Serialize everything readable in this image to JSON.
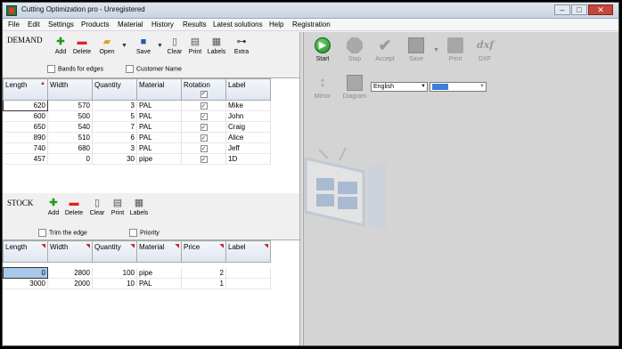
{
  "window": {
    "title": "Cutting Optimization pro - Unregistered",
    "controls": {
      "minimize": "–",
      "maximize": "□",
      "close": "✕"
    }
  },
  "menu": [
    "File",
    "Edit",
    "Settings",
    "Products",
    "Material",
    "History",
    "Results",
    "Latest solutions",
    "Help",
    "Registration"
  ],
  "demand": {
    "title": "DEMAND",
    "toolbar": {
      "add": "Add",
      "delete": "Delete",
      "open": "Open",
      "save": "Save",
      "clear": "Clear",
      "print": "Print",
      "labels": "Labels",
      "extra": "Extra"
    },
    "bands_for_edges": "Bands for edges",
    "customer_name": "Customer Name",
    "columns": [
      "Length",
      "Width",
      "Quantity",
      "Material",
      "Rotation",
      "Label"
    ],
    "rows": [
      {
        "length": "620",
        "width": "570",
        "quantity": "3",
        "material": "PAL",
        "rotation": true,
        "label": "Mike"
      },
      {
        "length": "600",
        "width": "500",
        "quantity": "5",
        "material": "PAL",
        "rotation": true,
        "label": "John"
      },
      {
        "length": "650",
        "width": "540",
        "quantity": "7",
        "material": "PAL",
        "rotation": true,
        "label": "Craig"
      },
      {
        "length": "890",
        "width": "510",
        "quantity": "6",
        "material": "PAL",
        "rotation": true,
        "label": "Alice"
      },
      {
        "length": "740",
        "width": "680",
        "quantity": "3",
        "material": "PAL",
        "rotation": true,
        "label": "Jeff"
      },
      {
        "length": "457",
        "width": "0",
        "quantity": "30",
        "material": "pipe",
        "rotation": true,
        "label": "1D"
      }
    ]
  },
  "stock": {
    "title": "STOCK",
    "toolbar": {
      "add": "Add",
      "delete": "Delete",
      "clear": "Clear",
      "print": "Print",
      "labels": "Labels"
    },
    "trim_the_edge": "Trim the edge",
    "priority": "Priority",
    "columns": [
      "Length",
      "Width",
      "Quantity",
      "Material",
      "Price",
      "Label"
    ],
    "rows": [
      {
        "length": "0",
        "width": "2800",
        "quantity": "100",
        "material": "pipe",
        "price": "2",
        "label": ""
      },
      {
        "length": "3000",
        "width": "2000",
        "quantity": "10",
        "material": "PAL",
        "price": "1",
        "label": ""
      }
    ]
  },
  "right_toolbar": {
    "start": "Start",
    "stop": "Stop",
    "accept": "Accept",
    "save": "Save",
    "print": "Print",
    "dxf": "DXF",
    "dxf_icon_text": "dxf",
    "mirror": "Mirror",
    "diagram": "Diagram",
    "language": "English"
  },
  "colors": {
    "accent": "#1e8a1e",
    "selected": "#a8c8ec",
    "color_box": "#3d7fd6"
  }
}
